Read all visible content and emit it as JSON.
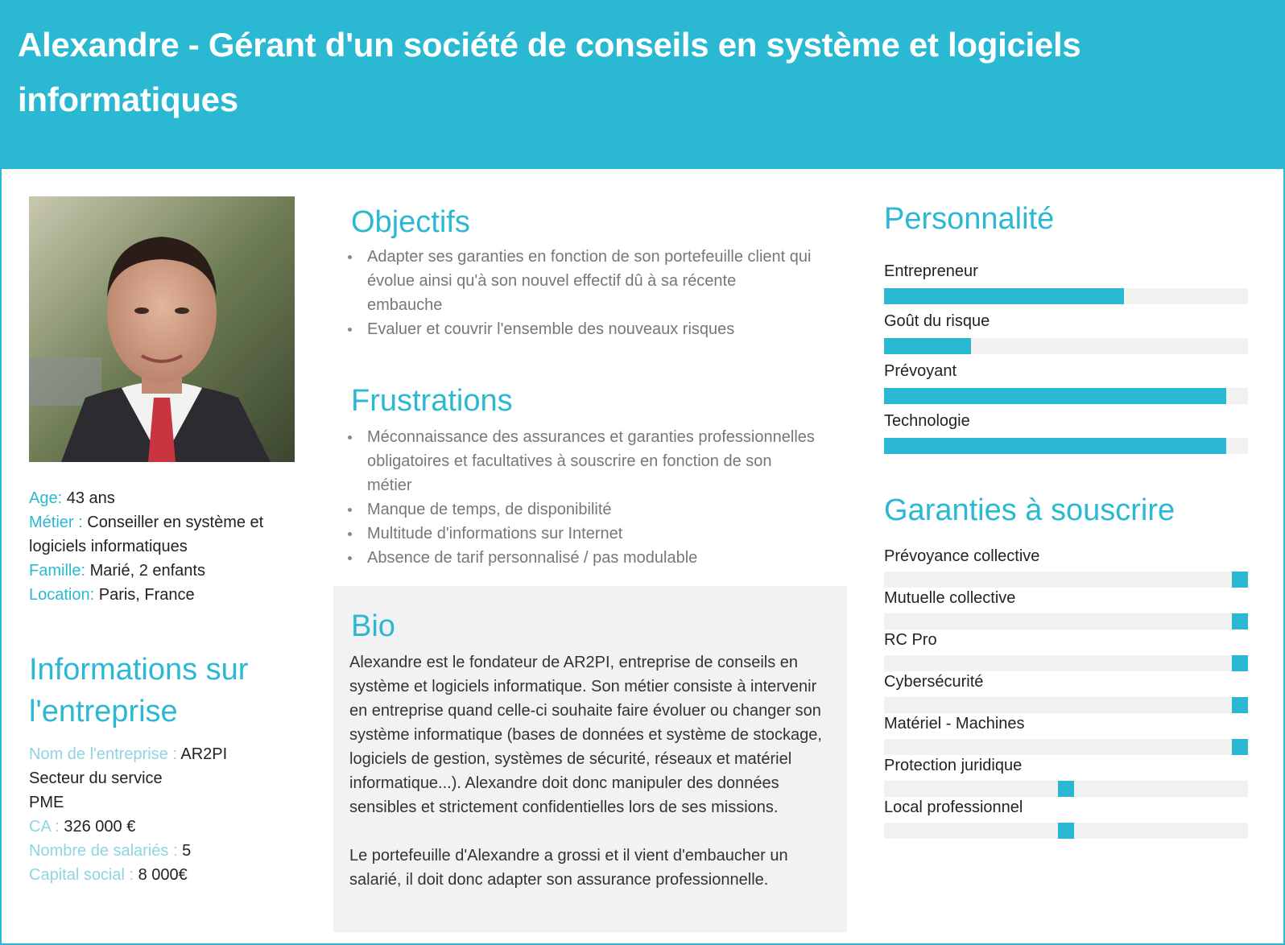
{
  "header": {
    "title": "Alexandre - Gérant d'un société de conseils en système et logiciels informatiques"
  },
  "profile": {
    "age_label": "Age:",
    "age_value": " 43 ans",
    "metier_label": "Métier :",
    "metier_value": " Conseiller en système et logiciels informatiques",
    "famille_label": "Famille:",
    "famille_value": " Marié, 2 enfants",
    "location_label": "Location:",
    "location_value": " Paris, France"
  },
  "company": {
    "title_line1": "Informations sur",
    "title_line2": "l'entreprise",
    "name_label": "Nom de l'entreprise :",
    "name_value": " AR2PI",
    "secteur": "Secteur du service",
    "taille": "PME",
    "ca_label": "CA :",
    "ca_value": " 326 000 €",
    "salaries_label": "Nombre de salariés :",
    "salaries_value": " 5",
    "capital_label": "Capital social :",
    "capital_value": " 8 000€"
  },
  "objectifs": {
    "title": "Objectifs",
    "items": [
      "Adapter ses garanties en fonction de son portefeuille client qui évolue ainsi qu'à son nouvel effectif dû à sa récente embauche",
      "Evaluer et couvrir l'ensemble des nouveaux risques"
    ]
  },
  "frustrations": {
    "title": "Frustrations",
    "items": [
      "Méconnaissance des assurances et garanties professionnelles obligatoires et facultatives à souscrire en fonction de son métier",
      "Manque de temps, de disponibilité",
      "Multitude d'informations sur Internet",
      "Absence de tarif personnalisé / pas modulable"
    ]
  },
  "bio": {
    "title": "Bio",
    "paragraph1": "Alexandre est le fondateur de AR2PI, entreprise de conseils en système et logiciels informatique. Son métier consiste à intervenir en entreprise quand celle-ci souhaite faire évoluer ou changer son système informatique (bases de données et système de stockage, logiciels de gestion, systèmes de sécurité, réseaux et matériel informatique...). Alexandre doit donc manipuler des données sensibles et strictement confidentielles lors de ses missions.",
    "paragraph2": "Le portefeuille d'Alexandre a grossi et il vient d'embaucher un salarié, il doit donc adapter son assurance professionnelle."
  },
  "personnalite": {
    "title": "Personnalité",
    "items": [
      {
        "label": "Entrepreneur",
        "level": 0.66
      },
      {
        "label": "Goût du risque",
        "level": 0.24
      },
      {
        "label": "Prévoyant",
        "level": 0.94
      },
      {
        "label": "Technologie",
        "level": 0.94
      }
    ]
  },
  "garanties": {
    "title": "Garanties à souscrire",
    "items": [
      {
        "label": "Prévoyance collective",
        "level": 1.0
      },
      {
        "label": "Mutuelle collective",
        "level": 1.0
      },
      {
        "label": "RC Pro",
        "level": 1.0
      },
      {
        "label": "Cybersécurité",
        "level": 1.0
      },
      {
        "label": "Matériel - Machines",
        "level": 1.0
      },
      {
        "label": "Protection juridique",
        "level": 0.5
      },
      {
        "label": "Local professionnel",
        "level": 0.5
      }
    ]
  },
  "colors": {
    "accent": "#2bb8d2",
    "track": "#f2f2f2"
  }
}
